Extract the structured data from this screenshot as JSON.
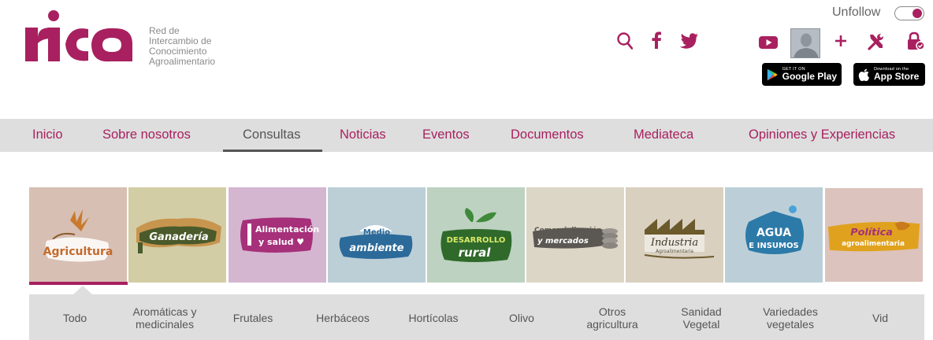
{
  "brand": {
    "logo_text": "rica",
    "tagline_lines": [
      "Red de",
      "Intercambio de",
      "Conocimiento",
      "Agroalimentario"
    ],
    "color": "#a8205f"
  },
  "header": {
    "unfollow_label": "Unfollow",
    "toggle_on": true,
    "icons": [
      "search-icon",
      "facebook-icon",
      "twitter-icon",
      "youtube-icon",
      "avatar",
      "plus-icon",
      "tools-icon",
      "lock-icon"
    ],
    "google_play": {
      "small": "GET IT ON",
      "big": "Google Play"
    },
    "app_store": {
      "small": "Download on the",
      "big": "App Store"
    }
  },
  "nav": {
    "items": [
      "Inicio",
      "Sobre nosotros",
      "Consultas",
      "Noticias",
      "Eventos",
      "Documentos",
      "Mediateca",
      "Opiniones y Experiencias"
    ],
    "active": "Consultas"
  },
  "categories": [
    {
      "label": "Agricultura",
      "bg": "#d7bfb3",
      "selected": true
    },
    {
      "label": "Ganadería",
      "bg": "#d3cda6"
    },
    {
      "label": "Alimentación y salud",
      "bg": "#d4b6d1"
    },
    {
      "label": "Medio ambiente",
      "bg": "#bccfd7"
    },
    {
      "label": "DESARROLLO rural",
      "bg": "#bdd2c1"
    },
    {
      "label": "Comercialización y mercados",
      "bg": "#dcd6c6"
    },
    {
      "label": "Industria Agroalimentaria",
      "bg": "#d9d0c0"
    },
    {
      "label": "AGUA E INSUMOS",
      "bg": "#bccfd8"
    },
    {
      "label": "Política agroalimentaria",
      "bg": "#dcc3bd"
    }
  ],
  "subnav": {
    "items": [
      [
        "Todo"
      ],
      [
        "Aromáticas y",
        "medicinales"
      ],
      [
        "Frutales"
      ],
      [
        "Herbáceos"
      ],
      [
        "Hortícolas"
      ],
      [
        "Olivo"
      ],
      [
        "Otros",
        "agricultura"
      ],
      [
        "Sanidad",
        "Vegetal"
      ],
      [
        "Variedades",
        "vegetales"
      ],
      [
        "Vid"
      ]
    ]
  }
}
